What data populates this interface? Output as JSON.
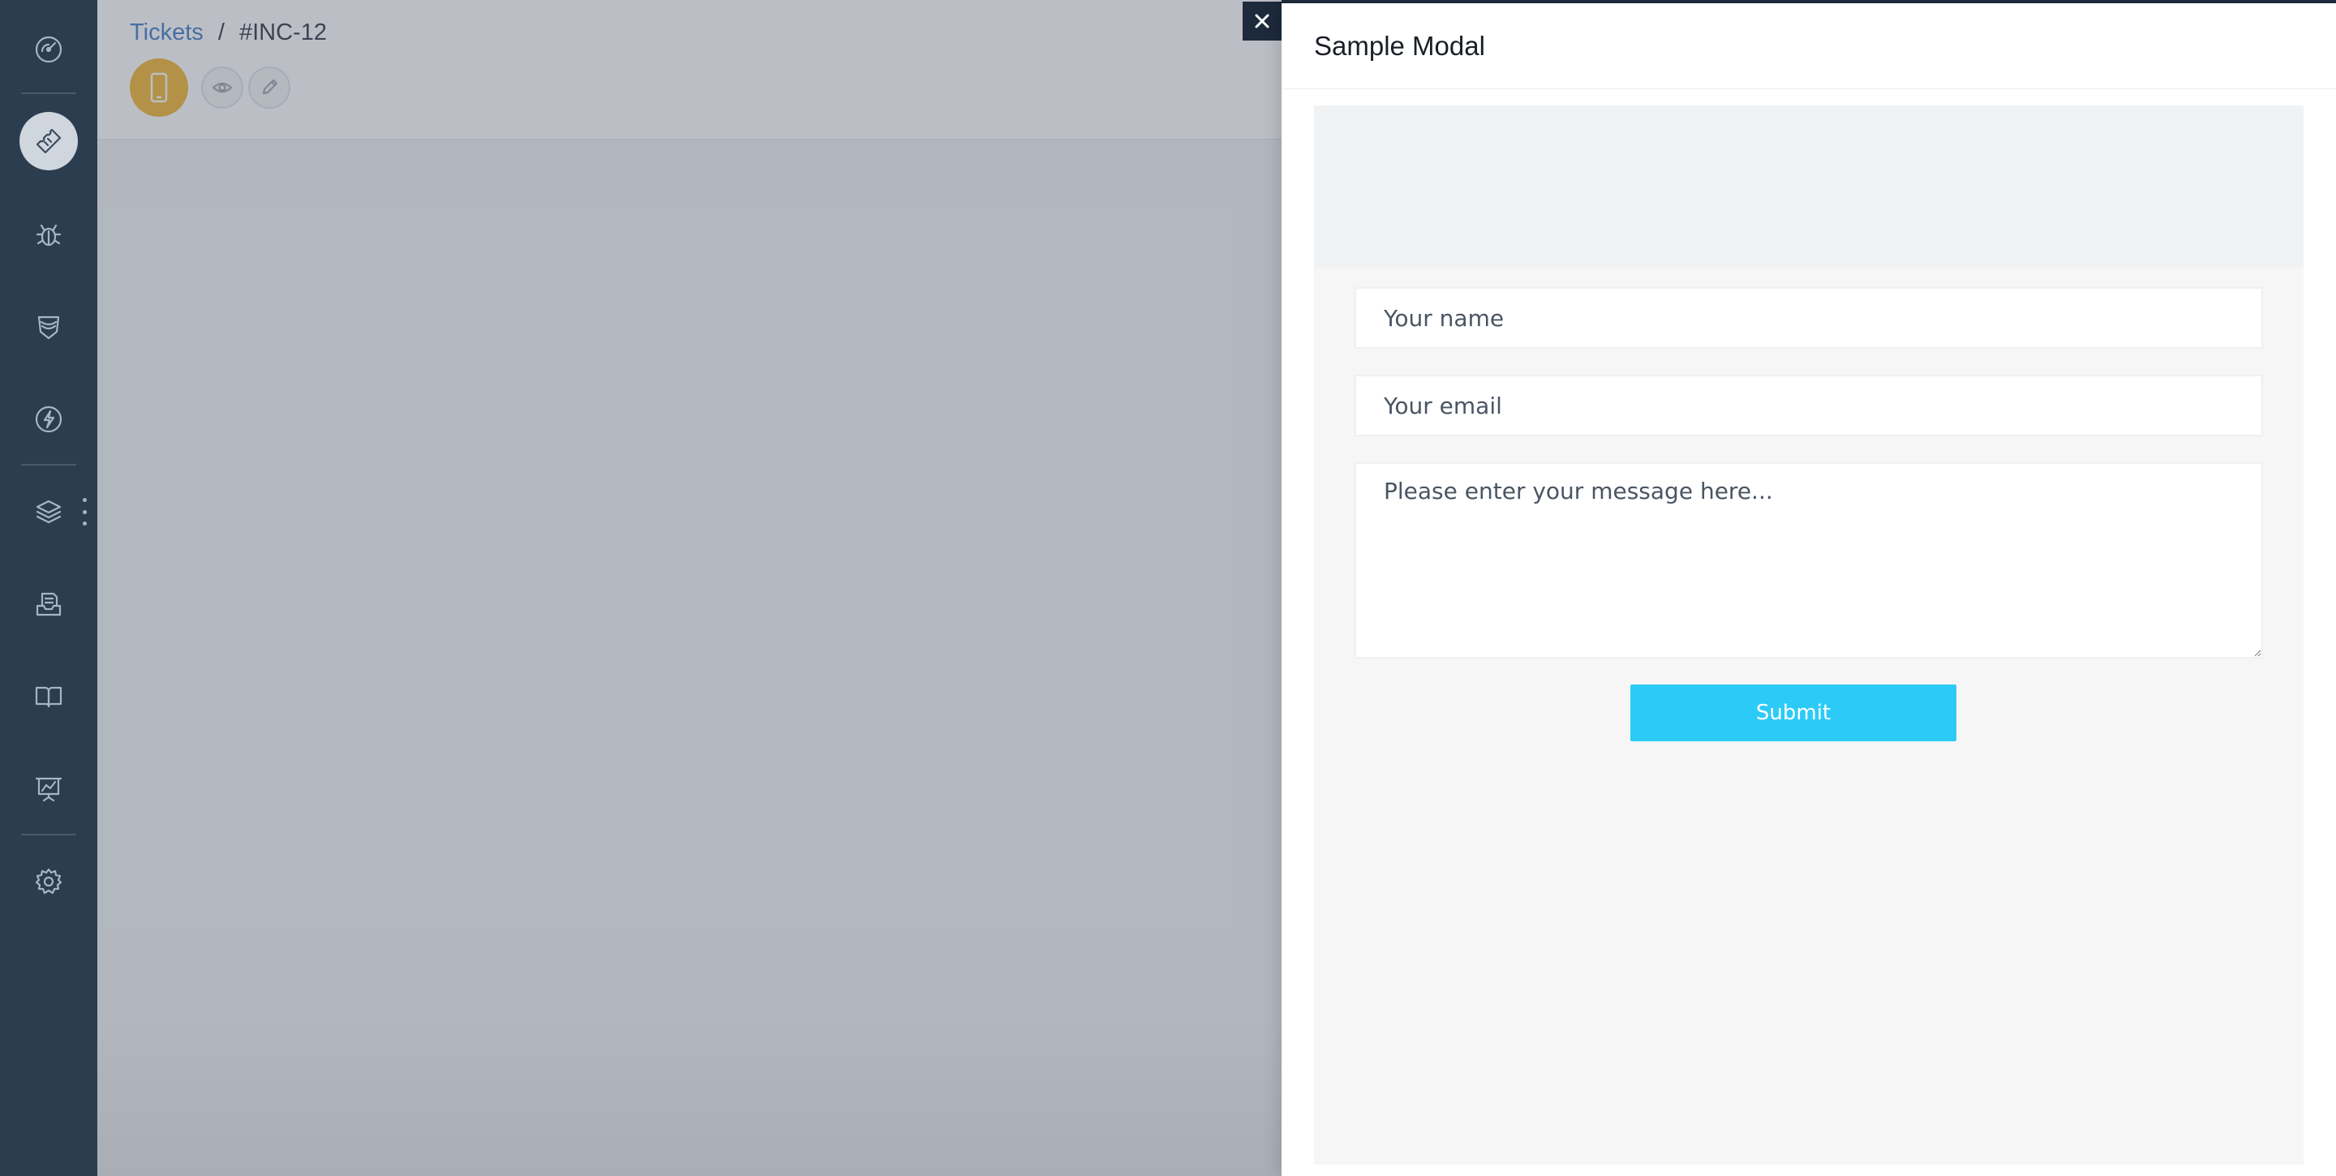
{
  "sidebar": {
    "items": [
      {
        "name": "dashboard",
        "icon": "gauge-icon",
        "active": false
      },
      {
        "name": "tickets",
        "icon": "ticket-icon",
        "active": true
      },
      {
        "name": "bugs",
        "icon": "bug-icon",
        "active": false
      },
      {
        "name": "security",
        "icon": "shield-icon",
        "active": false
      },
      {
        "name": "automation",
        "icon": "lightning-icon",
        "active": false
      },
      {
        "name": "layers",
        "icon": "layers-icon",
        "active": false
      },
      {
        "name": "reports",
        "icon": "inbox-document-icon",
        "active": false
      },
      {
        "name": "knowledge-base",
        "icon": "book-icon",
        "active": false
      },
      {
        "name": "analytics",
        "icon": "chart-board-icon",
        "active": false
      },
      {
        "name": "settings",
        "icon": "gear-icon",
        "active": false
      }
    ]
  },
  "breadcrumb": {
    "parent": "Tickets",
    "separator": "/",
    "current": "#INC-12"
  },
  "ticket": {
    "type_icon": "mobile-phone-icon",
    "type_color": "#f2b32e",
    "actions": [
      "eye-icon",
      "pencil-icon"
    ]
  },
  "modal": {
    "title": "Sample Modal",
    "close_icon": "close-icon",
    "form": {
      "name_placeholder": "Your name",
      "name_value": "",
      "email_placeholder": "Your email",
      "email_value": "",
      "message_placeholder": "Please enter your message here...",
      "message_value": "",
      "submit_label": "Submit",
      "submit_color": "#2ccbf7"
    }
  },
  "colors": {
    "sidebar_bg": "#2c3d50",
    "link": "#3f79c5",
    "modal_accent": "#1c2a3b"
  }
}
